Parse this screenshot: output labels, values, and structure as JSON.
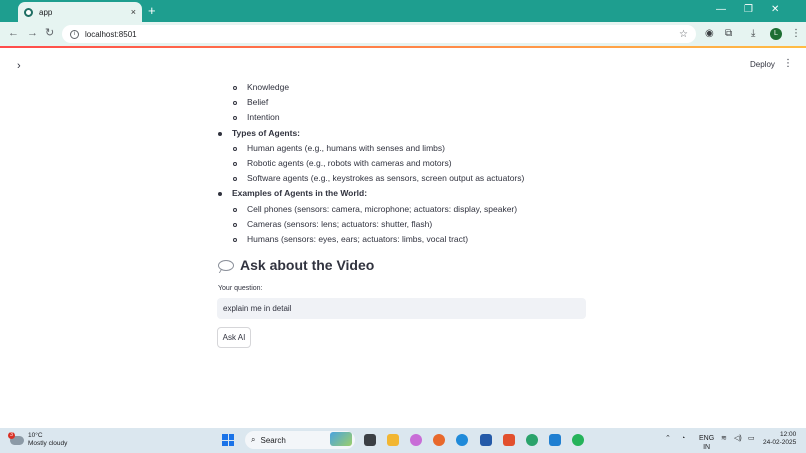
{
  "browser": {
    "tab_title": "app",
    "tab_close": "×",
    "new_tab": "+",
    "url": "localhost:8501",
    "profile_initial": "L"
  },
  "header": {
    "deploy_label": "Deploy",
    "menu_glyph": "⋮",
    "sidebar_toggle_glyph": "›"
  },
  "list": [
    {
      "level": 2,
      "text": "Knowledge"
    },
    {
      "level": 2,
      "text": "Belief"
    },
    {
      "level": 2,
      "text": "Intention"
    },
    {
      "level": 1,
      "text": "Types of Agents:"
    },
    {
      "level": 2,
      "text": "Human agents (e.g., humans with senses and limbs)"
    },
    {
      "level": 2,
      "text": "Robotic agents (e.g., robots with cameras and motors)"
    },
    {
      "level": 2,
      "text": "Software agents (e.g., keystrokes as sensors, screen output as actuators)"
    },
    {
      "level": 1,
      "text": "Examples of Agents in the World:"
    },
    {
      "level": 2,
      "text": "Cell phones (sensors: camera, microphone; actuators: display, speaker)"
    },
    {
      "level": 2,
      "text": "Cameras (sensors: lens; actuators: shutter, flash)"
    },
    {
      "level": 2,
      "text": "Humans (sensors: eyes, ears; actuators: limbs, vocal tract)"
    }
  ],
  "ask": {
    "heading": "Ask about the Video",
    "field_label": "Your question:",
    "input_value": "explain me in detail",
    "button_label": "Ask AI"
  },
  "taskbar": {
    "weather_badge": "3",
    "weather_temp": "10°C",
    "weather_desc": "Mostly cloudy",
    "search_label": "Search",
    "lang_line1": "ENG",
    "lang_line2": "IN",
    "time": "12:00",
    "date": "24-02-2025"
  },
  "colors": {
    "tab_strip": "#1e9e8f",
    "streamlit_accent": "#ff4b4b",
    "input_background": "#f0f2f6"
  }
}
